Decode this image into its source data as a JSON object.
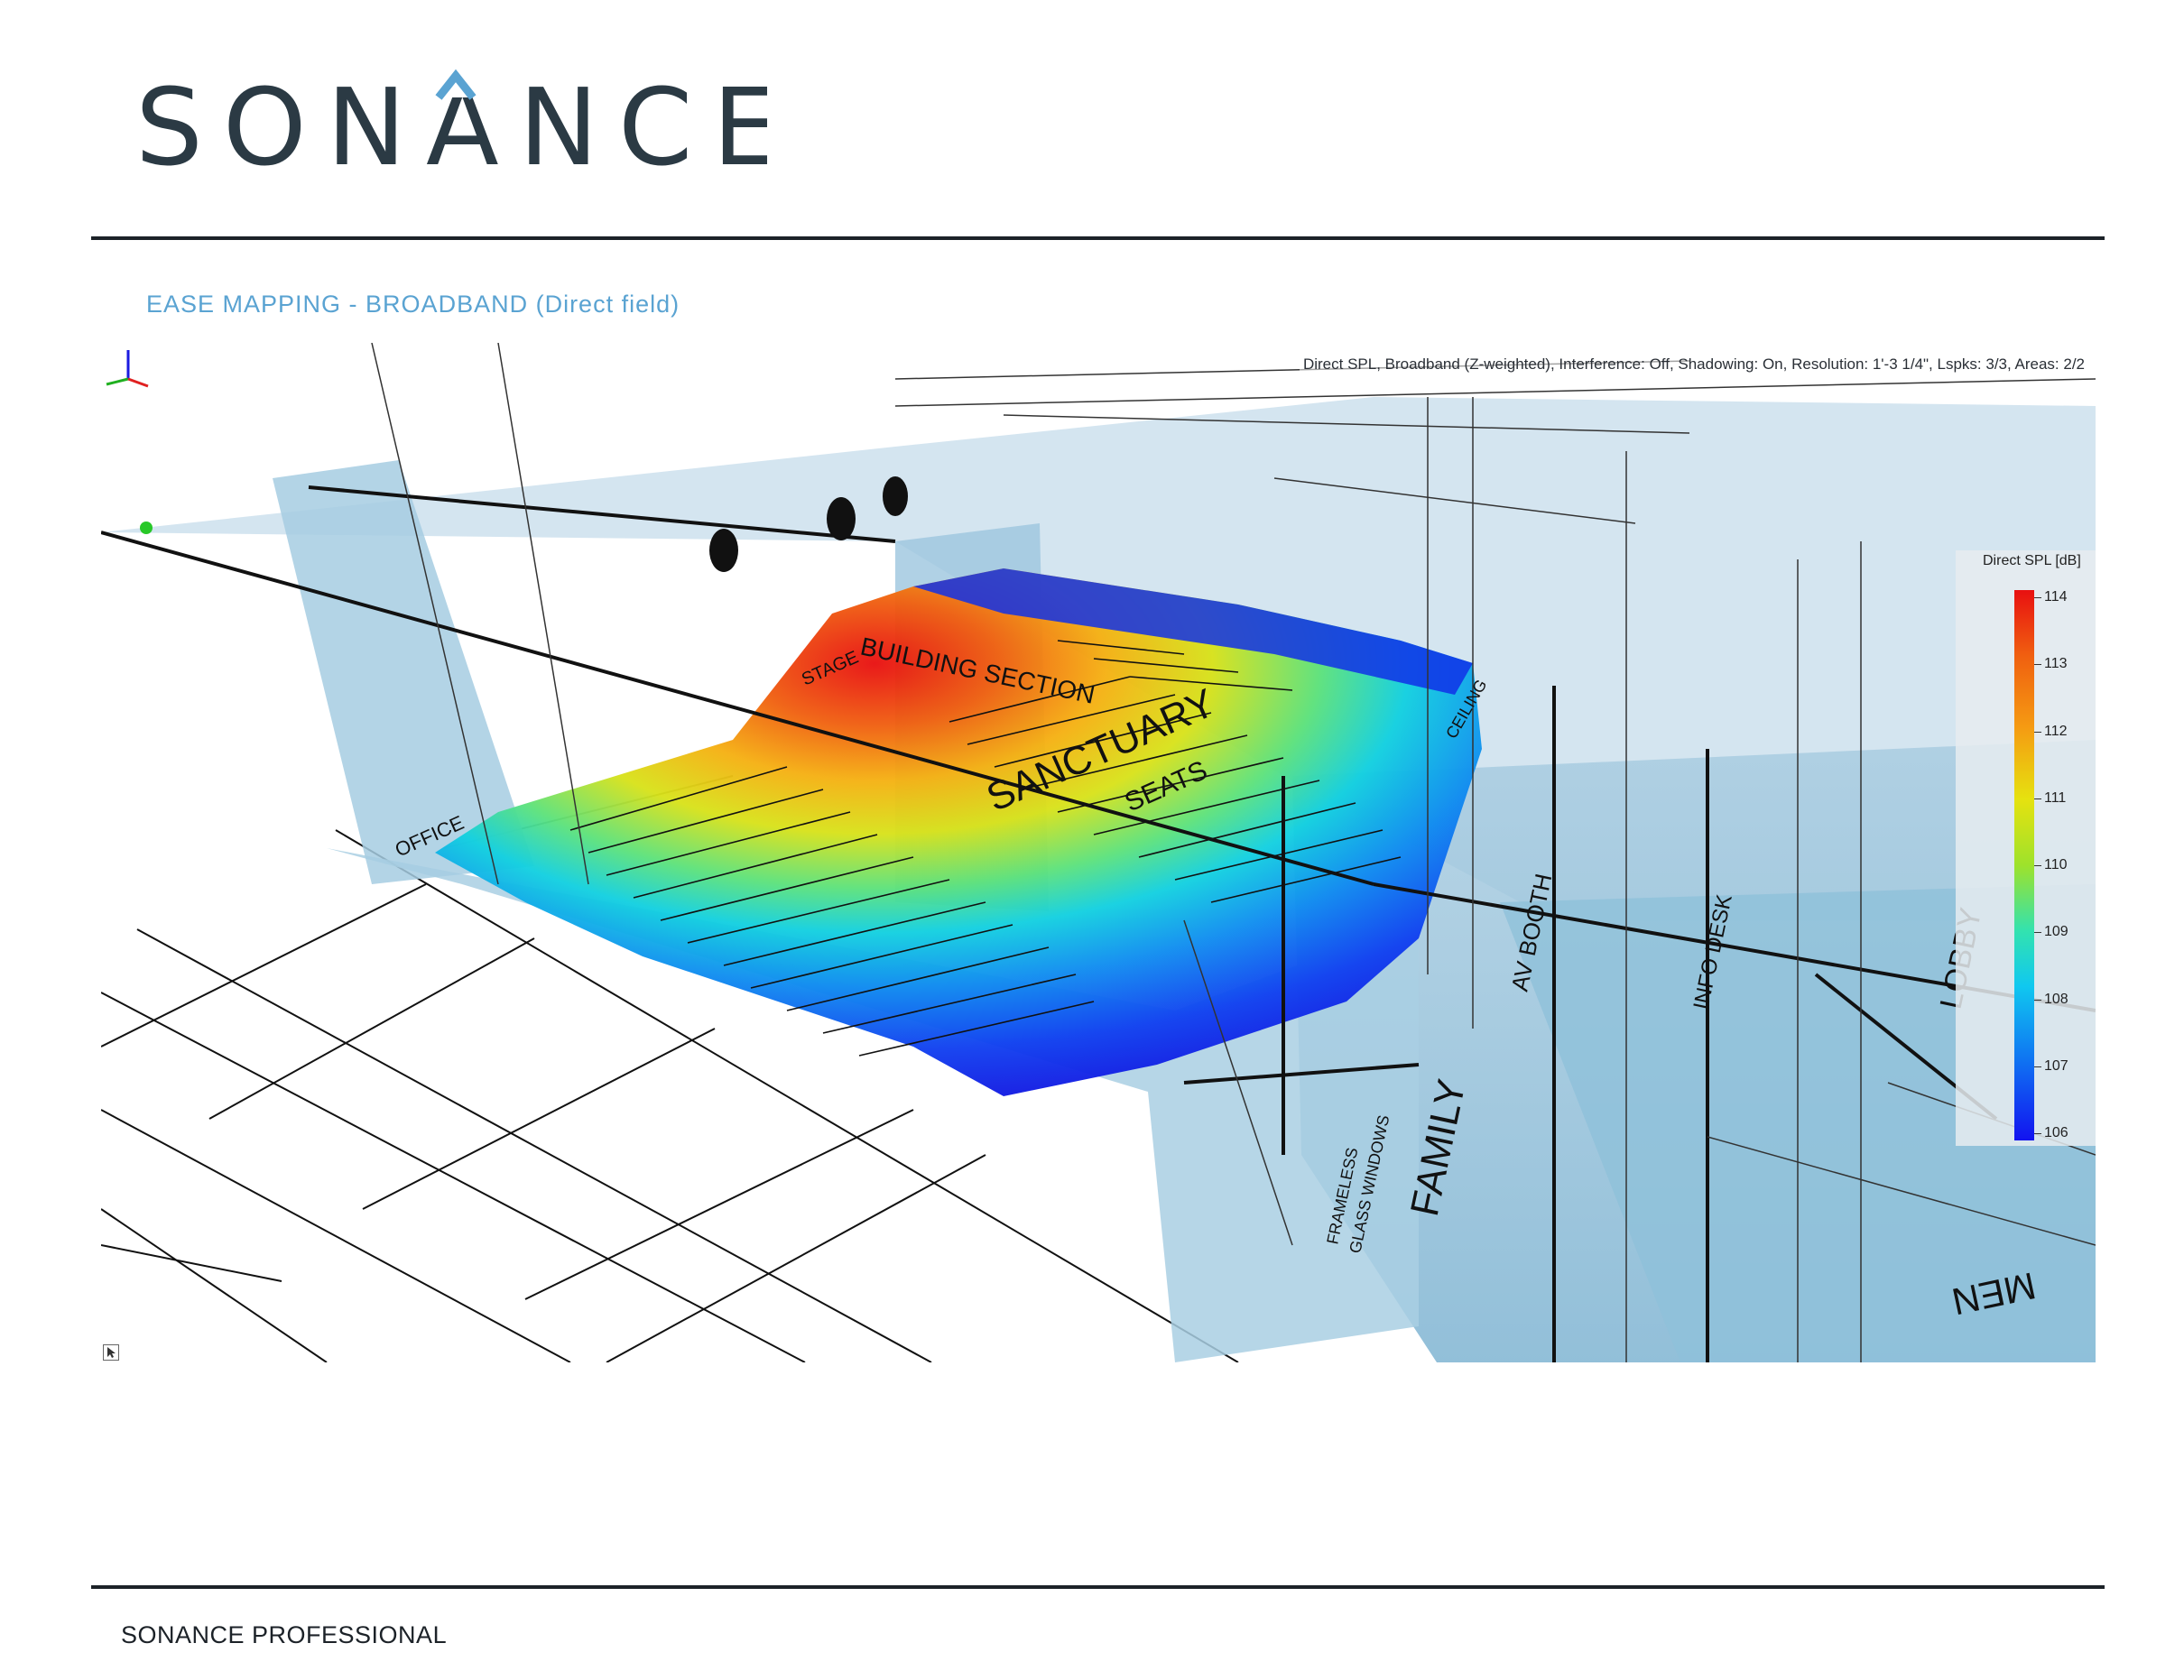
{
  "brand": {
    "logo_text": "SONANCE",
    "color_dark": "#2b3a44",
    "color_accent": "#5aa3d2"
  },
  "section_title": "EASE MAPPING - BROADBAND (Direct field)",
  "figure": {
    "caption": "Direct SPL, Broadband (Z-weighted), Interference: Off, Shadowing: On, Resolution: 1'-3 1/4\", Lspks: 3/3, Areas: 2/2",
    "labels": {
      "building_section": "BUILDING SECTION",
      "sanctuary": "SANCTUARY",
      "seats": "SEATS",
      "office": "OFFICE",
      "stage": "STAGE",
      "family": "FAMILY",
      "frameless": "FRAMELESS",
      "glass_windows": "GLASS WINDOWS",
      "av_booth": "AV BOOTH",
      "info_desk": "INFO DESK",
      "lobby": "LOBBY",
      "men": "MEN",
      "ceiling": "CEILING"
    },
    "legend": {
      "title": "Direct SPL [dB]",
      "ticks": [
        "114",
        "113",
        "112",
        "111",
        "110",
        "109",
        "108",
        "107",
        "106"
      ],
      "colors": [
        "#e81010",
        "#f59b12",
        "#e6e20f",
        "#32e2b0",
        "#0f76f2",
        "#1212f0"
      ]
    }
  },
  "footer": "SONANCE PROFESSIONAL"
}
